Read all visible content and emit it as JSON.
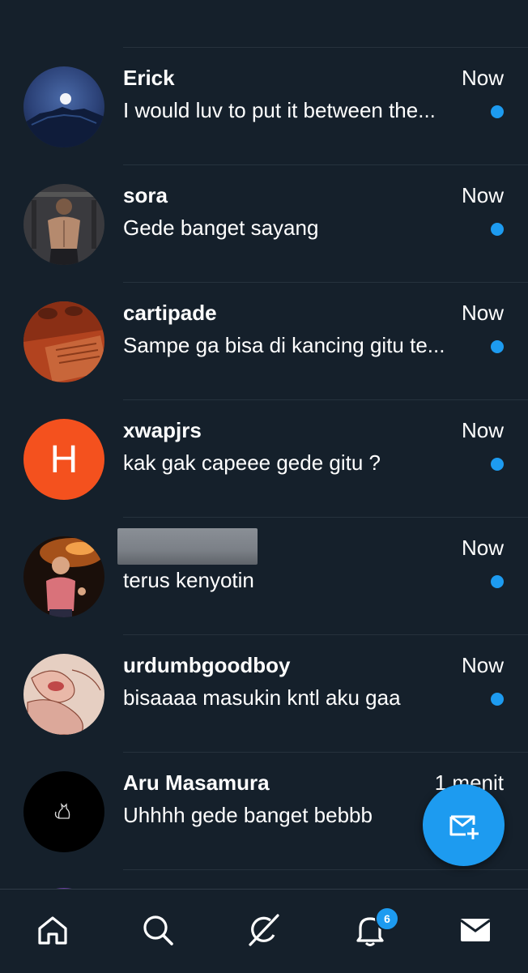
{
  "conversations": [
    {
      "name": "Erick",
      "time": "Now",
      "preview": "I would luv to put it between the...",
      "unread": true,
      "avatar": "photo-moon-night"
    },
    {
      "name": "sora",
      "time": "Now",
      "preview": "Gede banget sayang",
      "unread": true,
      "avatar": "photo-gym-back"
    },
    {
      "name": "cartipade",
      "time": "Now",
      "preview": "Sampe ga bisa di kancing gitu te...",
      "unread": true,
      "avatar": "photo-orange-room"
    },
    {
      "name": "xwapjrs",
      "time": "Now",
      "preview": "kak gak capeee gede gitu ?",
      "unread": true,
      "avatar_letter": "H",
      "avatar_color": "#f4511e"
    },
    {
      "name": "",
      "time": "Now",
      "preview": "terus kenyotin",
      "unread": true,
      "avatar": "photo-child-fire",
      "name_redacted": true
    },
    {
      "name": "urdumbgoodboy",
      "time": "Now",
      "preview": "bisaaaa masukin kntl aku gaa",
      "unread": true,
      "avatar": "photo-drawing"
    },
    {
      "name": "Aru Masamura",
      "time": "1 menit",
      "preview": "Uhhhh gede banget bebbb",
      "unread": false,
      "avatar": "cat-icon-black"
    }
  ],
  "fab": {
    "icon": "new-message-icon"
  },
  "bottom_nav": {
    "items": [
      "home-icon",
      "search-icon",
      "grok-icon",
      "notifications-icon",
      "messages-icon"
    ],
    "notifications_badge": "6",
    "active": "messages-icon"
  },
  "colors": {
    "background": "#15202b",
    "accent": "#1d9bf0",
    "divider": "#26323d"
  }
}
